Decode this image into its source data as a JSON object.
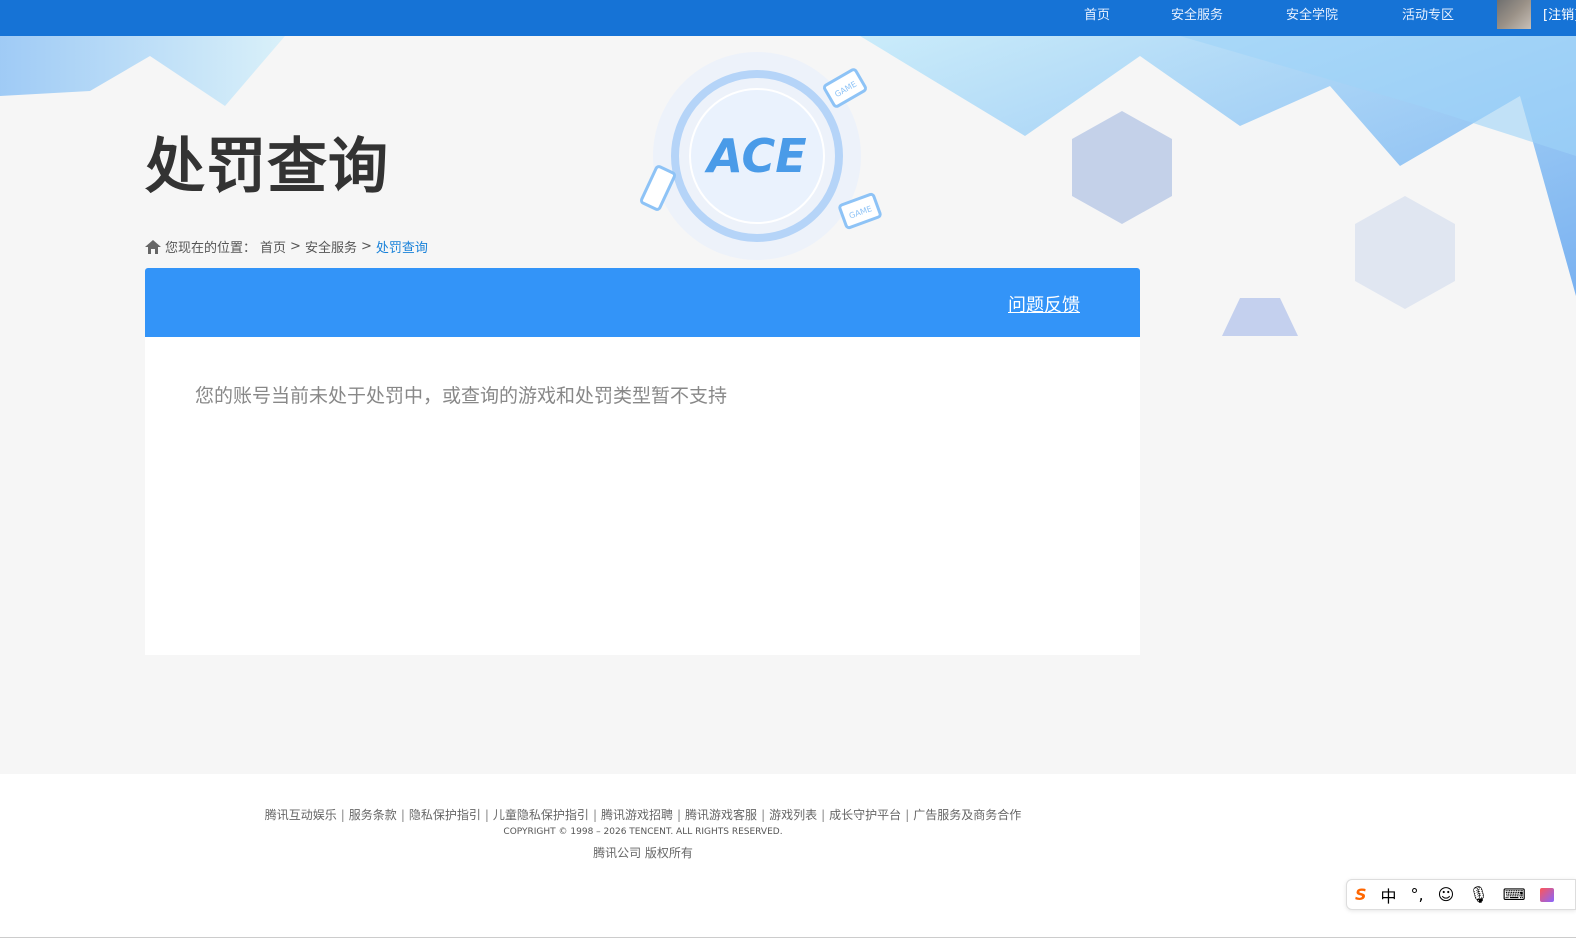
{
  "topnav": {
    "items": [
      "首页",
      "安全服务",
      "安全学院",
      "活动专区"
    ],
    "logout": "[注销]"
  },
  "page": {
    "title": "处罚查询",
    "logo_text": "ACE",
    "badge_text": "GAME"
  },
  "breadcrumb": {
    "prefix": "您现在的位置：",
    "items": [
      "首页",
      "安全服务"
    ],
    "current": "处罚查询",
    "sep": ">"
  },
  "panel": {
    "feedback": "问题反馈",
    "message": "您的账号当前未处于处罚中，或查询的游戏和处罚类型暂不支持"
  },
  "footer": {
    "links": [
      "腾讯互动娱乐",
      "服务条款",
      "隐私保护指引",
      "儿童隐私保护指引",
      "腾讯游戏招聘",
      "腾讯游戏客服",
      "游戏列表",
      "成长守护平台",
      "广告服务及商务合作"
    ],
    "copyright": "COPYRIGHT © 1998 – 2026 TENCENT. ALL RIGHTS RESERVED.",
    "rights": "腾讯公司 版权所有"
  },
  "ime": {
    "mode": "中"
  },
  "colors": {
    "topbar": "#1673d6",
    "panel_header": "#3394f8",
    "breadcrumb_current": "#1a82d9"
  }
}
